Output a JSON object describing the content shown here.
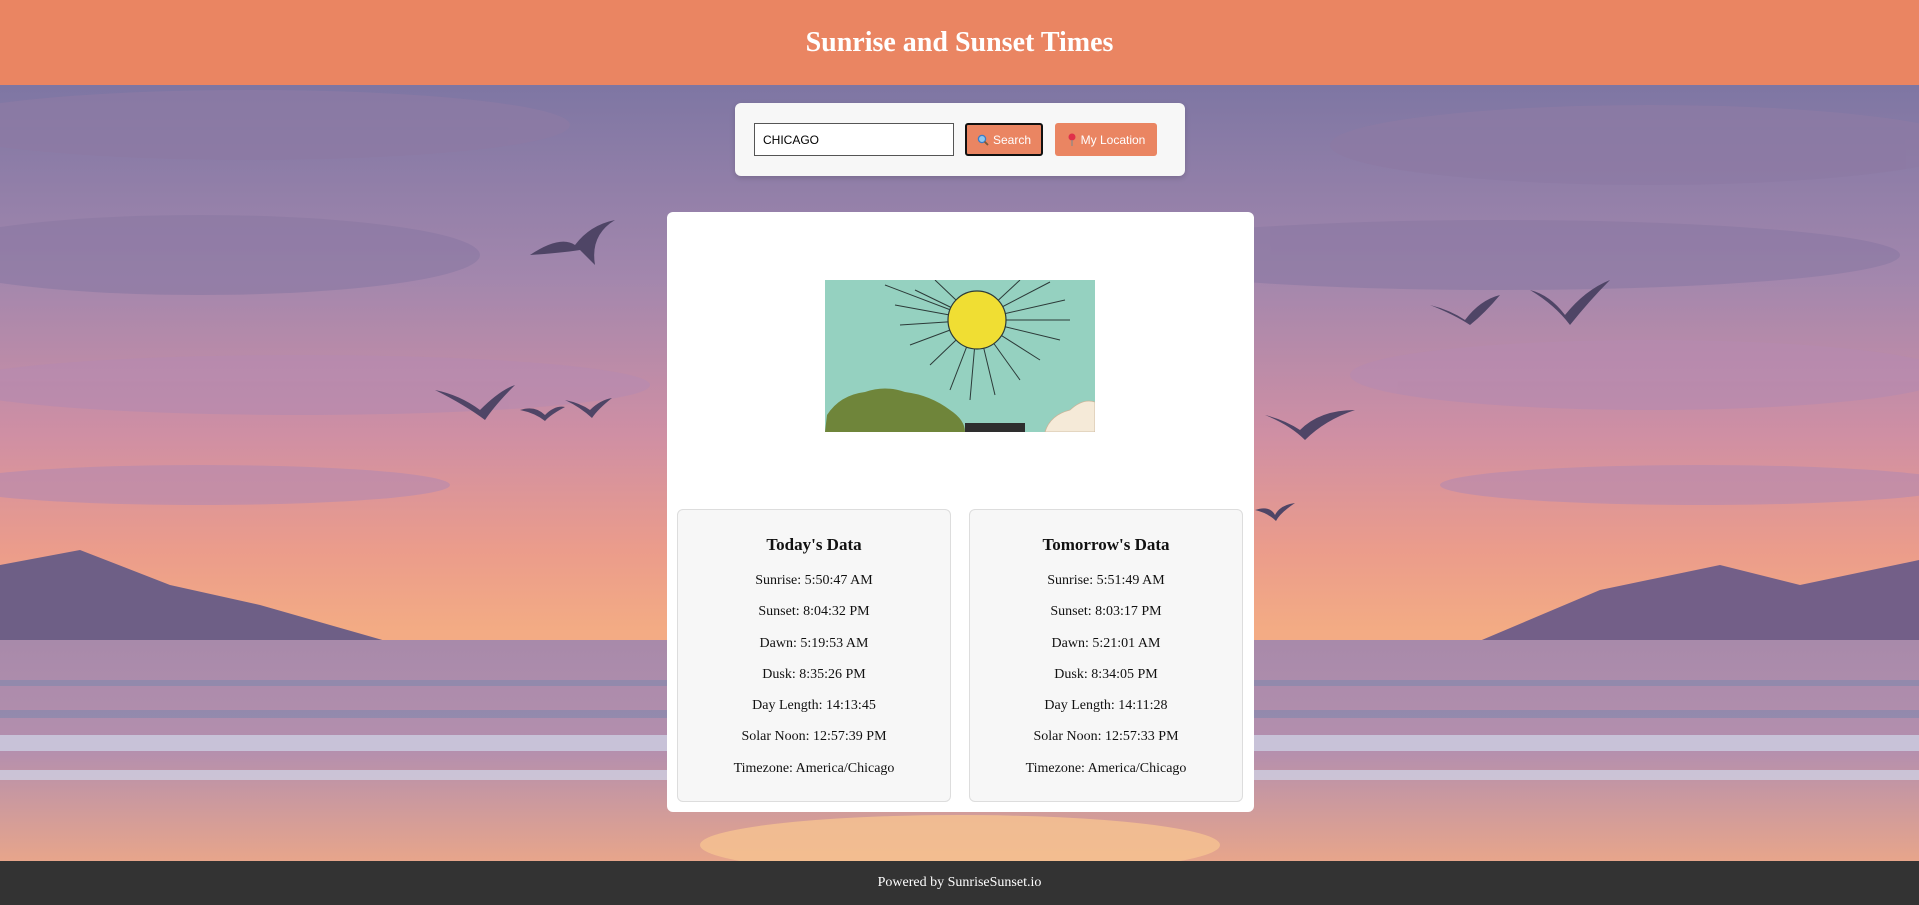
{
  "header": {
    "title": "Sunrise and Sunset Times"
  },
  "search": {
    "value": "CHICAGO",
    "search_label": "Search",
    "location_label": "My Location",
    "search_icon": "magnifier-icon",
    "location_icon": "pin-icon"
  },
  "today": {
    "heading": "Today's Data",
    "sunrise": "Sunrise: 5:50:47 AM",
    "sunset": "Sunset: 8:04:32 PM",
    "dawn": "Dawn: 5:19:53 AM",
    "dusk": "Dusk: 8:35:26 PM",
    "day_length": "Day Length: 14:13:45",
    "solar_noon": "Solar Noon: 12:57:39 PM",
    "timezone": "Timezone: America/Chicago"
  },
  "tomorrow": {
    "heading": "Tomorrow's Data",
    "sunrise": "Sunrise: 5:51:49 AM",
    "sunset": "Sunset: 8:03:17 PM",
    "dawn": "Dawn: 5:21:01 AM",
    "dusk": "Dusk: 8:34:05 PM",
    "day_length": "Day Length: 14:11:28",
    "solar_noon": "Solar Noon: 12:57:33 PM",
    "timezone": "Timezone: America/Chicago"
  },
  "footer": {
    "text": "Powered by SunriseSunset.io"
  },
  "colors": {
    "accent": "#ea8562",
    "footer": "#333333",
    "panel": "#f7f7f7"
  }
}
